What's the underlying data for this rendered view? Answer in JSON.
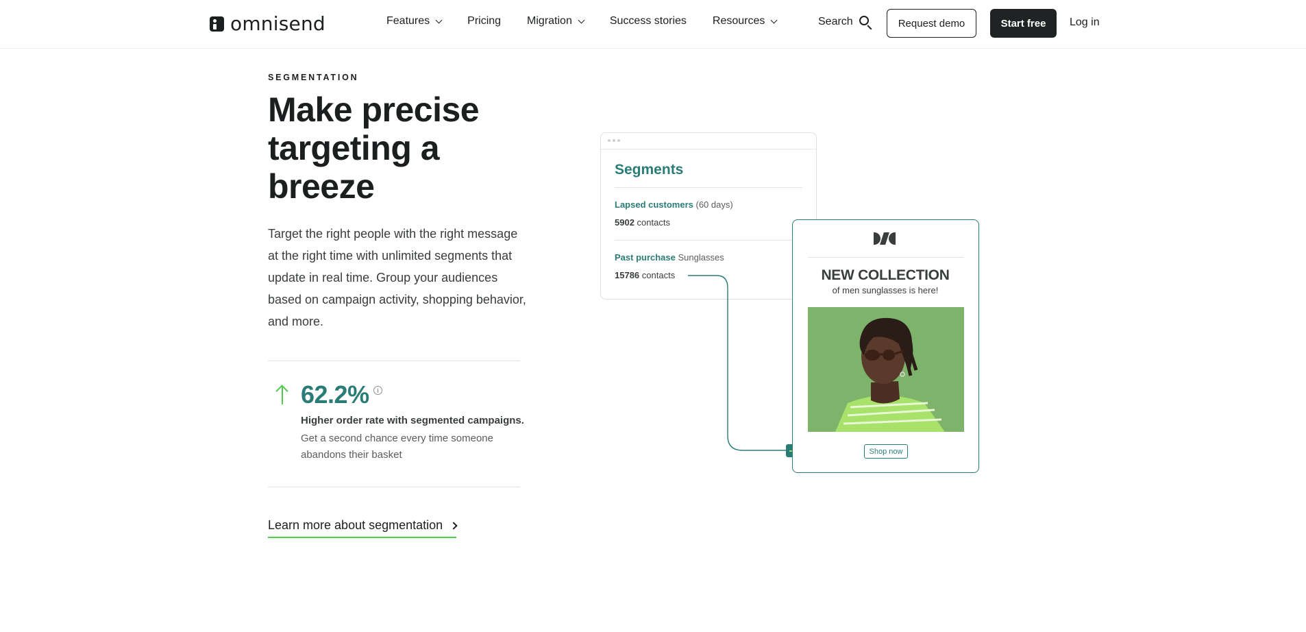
{
  "header": {
    "logo_text": "omnisend",
    "nav": [
      {
        "label": "Features",
        "has_dropdown": true
      },
      {
        "label": "Pricing",
        "has_dropdown": false
      },
      {
        "label": "Migration",
        "has_dropdown": true
      },
      {
        "label": "Success stories",
        "has_dropdown": false
      },
      {
        "label": "Resources",
        "has_dropdown": true
      }
    ],
    "search_label": "Search",
    "request_demo_label": "Request demo",
    "start_free_label": "Start free",
    "login_label": "Log in"
  },
  "hero": {
    "eyebrow": "SEGMENTATION",
    "headline": "Make precise targeting a breeze",
    "description": "Target the right people with the right message at the right time with unlimited segments that update in real time. Group your audiences based on campaign activity, shopping behavior, and more."
  },
  "stat": {
    "value": "62.2%",
    "info_symbol": "i",
    "title": "Higher order rate with segmented campaigns.",
    "description": "Get a second chance every time someone abandons their basket"
  },
  "learn_more": {
    "label": "Learn more about segmentation"
  },
  "segments_card": {
    "title": "Segments",
    "rows": [
      {
        "name": "Lapsed customers",
        "detail": "(60 days)",
        "count": "5902",
        "count_suffix": "contacts"
      },
      {
        "name": "Past purchase",
        "detail": "Sunglasses",
        "count": "15786",
        "count_suffix": "contacts"
      }
    ]
  },
  "email_card": {
    "title": "NEW COLLECTION",
    "subtitle": "of men sunglasses is here!",
    "button_label": "Shop now"
  },
  "colors": {
    "accent_teal": "#2a7c77",
    "accent_green": "#4fc94f",
    "dark": "#1c1f1f",
    "image_bg": "#7db36b"
  },
  "icons": [
    "logo-icon",
    "chevron-down-icon",
    "search-icon",
    "arrow-up-icon",
    "info-icon",
    "chevron-right-icon",
    "arrow-right-icon",
    "brand-icon"
  ]
}
